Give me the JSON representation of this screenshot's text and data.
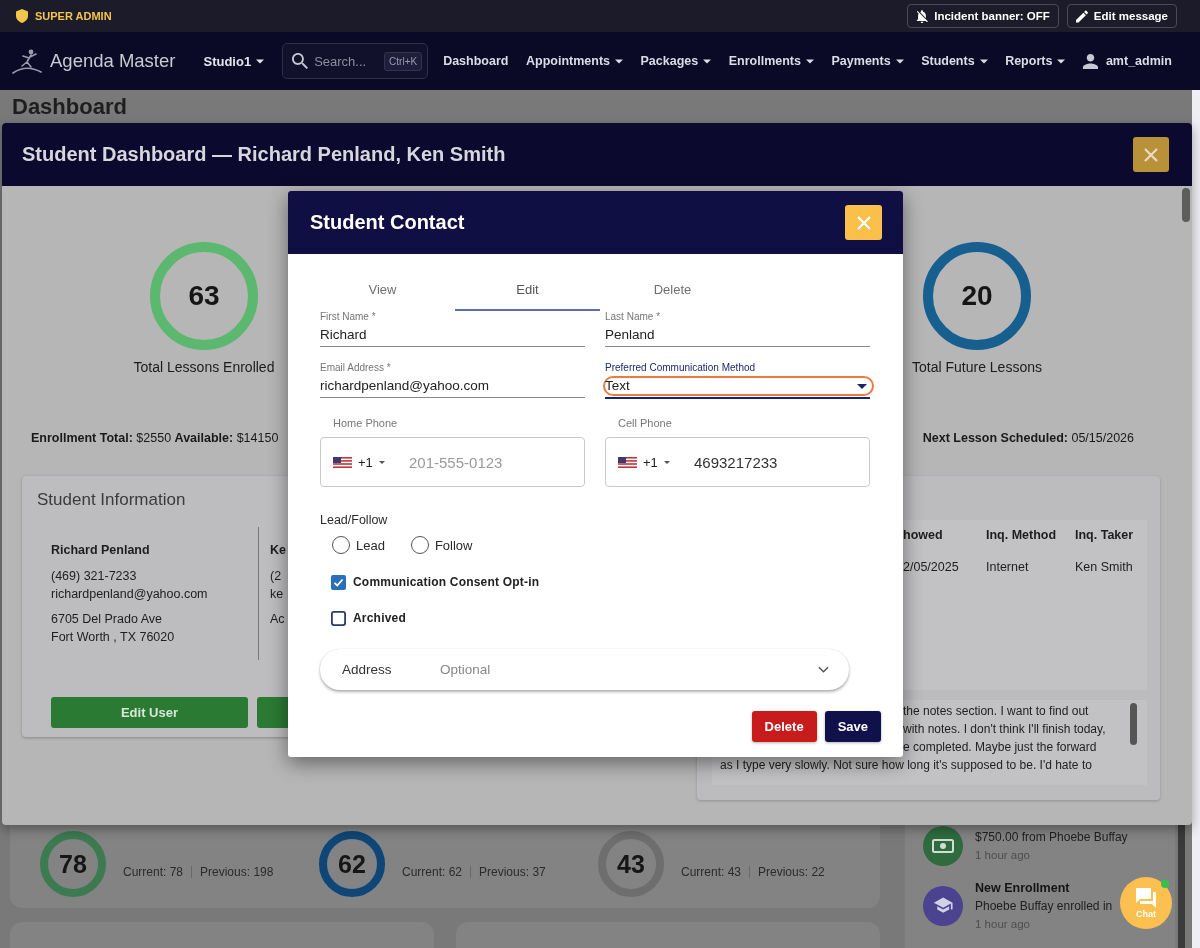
{
  "admin_bar": {
    "role": "SUPER ADMIN",
    "buttons": [
      {
        "kind": "banner",
        "label": "Incident banner: OFF"
      },
      {
        "kind": "edit",
        "label": "Edit message"
      }
    ]
  },
  "nav": {
    "brand": "Agenda Master",
    "studio": "Studio1",
    "search": {
      "placeholder": "Search...",
      "shortcut": "Ctrl+K"
    },
    "items": [
      {
        "label": "Dashboard",
        "dropdown": false
      },
      {
        "label": "Appointments",
        "dropdown": true
      },
      {
        "label": "Packages",
        "dropdown": true
      },
      {
        "label": "Enrollments",
        "dropdown": true
      },
      {
        "label": "Payments",
        "dropdown": true
      },
      {
        "label": "Students",
        "dropdown": true
      },
      {
        "label": "Reports",
        "dropdown": true
      }
    ],
    "user": "amt_admin"
  },
  "page": {
    "title": "Dashboard",
    "stats": [
      {
        "value": "78",
        "current": "Current: 78",
        "previous": "Previous: 198",
        "color": "#3c7a52"
      },
      {
        "value": "62",
        "current": "Current: 62",
        "previous": "Previous: 37",
        "color": "#0e4777"
      },
      {
        "value": "43",
        "current": "Current: 43",
        "previous": "Previous: 22",
        "color": "#6e6e6e"
      }
    ],
    "activity": [
      {
        "kind": "payment",
        "detail": "$750.00 from Phoebe Buffay",
        "time": "1 hour ago"
      },
      {
        "kind": "enrollment",
        "title": "New Enrollment",
        "detail": "Phoebe Buffay enrolled in",
        "time": "1 hour ago"
      }
    ]
  },
  "chat_button": {
    "label": "Chat",
    "online": true
  },
  "student_dashboard": {
    "title": "Student Dashboard — Richard Penland, Ken Smith",
    "stats": [
      {
        "value": "63",
        "label": "Total Lessons Enrolled",
        "color": "#5bb86e"
      },
      {
        "value": "20",
        "label": "Total Future Lessons",
        "color": "#165f8f"
      }
    ],
    "enrollment_summary": "**Enrollment Total:** $2550 **Available:** $14150",
    "next_lesson": "**Next Lesson Scheduled:** 05/15/2026",
    "student_info": {
      "title": "Student Information",
      "students": [
        {
          "name": "Richard Penland",
          "phone": "(469) 321-7233",
          "email": "richardpenland@yahoo.com",
          "address": [
            "6705 Del Prado Ave",
            "Fort Worth , TX 76020"
          ]
        },
        {
          "name": "Ke",
          "phone": "(2",
          "email": "ke",
          "address": [
            "Ac"
          ]
        }
      ],
      "buttons": [
        {
          "kind": "primary",
          "label": "Edit User"
        },
        {
          "kind": "primary"
        }
      ]
    },
    "inquiries": {
      "columns": [
        "howed",
        "Inq. Method",
        "Inq. Taker"
      ],
      "rows": [
        [
          "2/05/2025",
          "Internet",
          "Ken Smith"
        ]
      ]
    },
    "notes": {
      "lines": [
        {
          "text": "the notes section. I want to find out",
          "partly_covered": true
        },
        {
          "text": "with notes. I don't think I'll finish today,",
          "partly_covered": true
        },
        {
          "text": "e completed. Maybe just the forward",
          "partly_covered": true
        },
        {
          "text": "as I type very slowly. Not sure how long it's supposed to be. I'd hate to",
          "partly_covered": false
        }
      ]
    }
  },
  "contact_dialog": {
    "title": "Student Contact",
    "tabs": [
      {
        "label": "View",
        "selected": false
      },
      {
        "label": "Edit",
        "selected": true
      },
      {
        "label": "Delete",
        "selected": false
      }
    ],
    "fields": [
      {
        "kind": "text",
        "label": "First Name *",
        "value": "Richard",
        "focused": false,
        "highlighted": false
      },
      {
        "kind": "text",
        "label": "Last Name *",
        "value": "Penland",
        "focused": false,
        "highlighted": false
      },
      {
        "kind": "text",
        "label": "Email Address *",
        "value": "richardpenland@yahoo.com",
        "focused": false,
        "highlighted": false
      },
      {
        "kind": "select",
        "label": "Preferred Communication Method",
        "value": "Text",
        "focused": true,
        "highlighted": true
      }
    ],
    "phones": [
      {
        "label": "Home Phone",
        "country_code": "+1",
        "placeholder": "201-555-0123"
      },
      {
        "label": "Cell Phone",
        "country_code": "+1",
        "value": "4693217233"
      }
    ],
    "lead_follow": {
      "label": "Lead/Follow",
      "options": [
        {
          "label": "Lead",
          "selected": false
        },
        {
          "label": "Follow",
          "selected": false
        }
      ]
    },
    "checkboxes": [
      {
        "label": "Communication Consent Opt-in",
        "checked": true
      },
      {
        "label": "Archived",
        "checked": false
      }
    ],
    "address": {
      "label": "Address",
      "hint": "Optional",
      "expanded": false
    },
    "buttons": [
      {
        "kind": "danger",
        "label": "Delete"
      },
      {
        "kind": "primary",
        "label": "Save"
      }
    ]
  }
}
